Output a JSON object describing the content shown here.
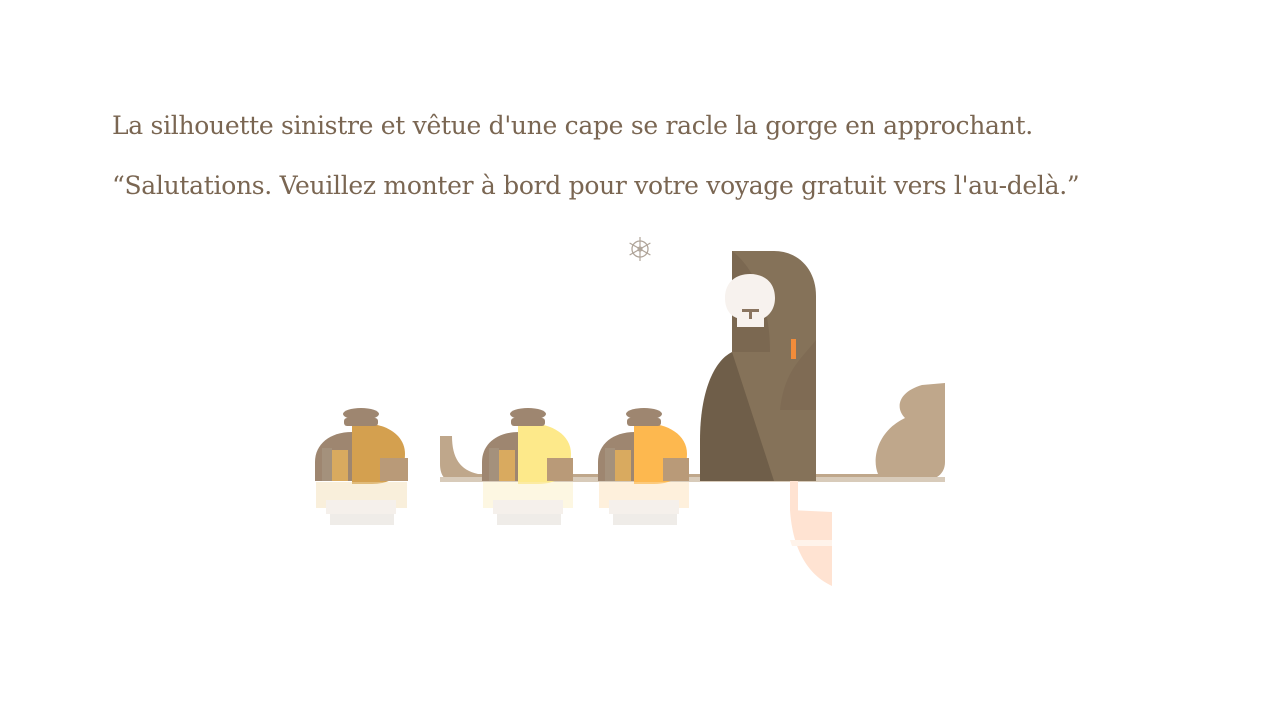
{
  "narration": {
    "line1": "La silhouette sinistre et vêtue d'une cape se racle la gorge en approchant.",
    "line2": "“Salutations. Veuillez monter à bord pour votre voyage gratuit vers l'au-delà.”"
  },
  "icons": {
    "settings": "ship-wheel-icon"
  },
  "colors": {
    "text": "#7a6652",
    "cloak": "#857259",
    "cloak_shadow": "#6f5e49",
    "boat": "#bfa78b",
    "skull": "#f7f2ee",
    "oar": "#ffe3d2",
    "accent": "#f28c3a",
    "hair1": "#d4a04f",
    "hair2": "#fde98a",
    "hair3": "#fdb84f"
  }
}
